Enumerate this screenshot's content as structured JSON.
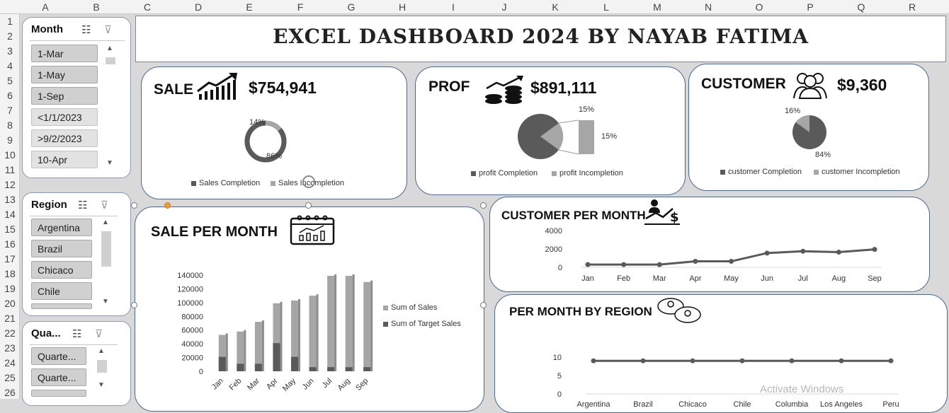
{
  "columns": [
    "A",
    "B",
    "C",
    "D",
    "E",
    "F",
    "G",
    "H",
    "I",
    "J",
    "K",
    "L",
    "M",
    "N",
    "O",
    "P",
    "Q",
    "R"
  ],
  "rows": [
    "1",
    "2",
    "3",
    "4",
    "5",
    "6",
    "7",
    "8",
    "9",
    "10",
    "11",
    "12",
    "13",
    "14",
    "15",
    "16",
    "17",
    "18",
    "19",
    "20",
    "21",
    "22",
    "23",
    "24",
    "25",
    "26"
  ],
  "title": "EXCEL DASHBOARD 2024 BY NAYAB FATIMA",
  "slicers": {
    "month": {
      "header": "Month",
      "items": [
        "1-Mar",
        "1-May",
        "1-Sep",
        "<1/1/2023",
        ">9/2/2023",
        "10-Apr"
      ]
    },
    "region": {
      "header": "Region",
      "items": [
        "Argentina",
        "Brazil",
        "Chicaco",
        "Chile"
      ]
    },
    "quarter": {
      "header": "Qua...",
      "items": [
        "Quarte...",
        "Quarte..."
      ]
    }
  },
  "kpis": {
    "sale": {
      "title": "SALE",
      "value": "$754,941",
      "pct_a": "14%",
      "pct_b": "86%",
      "legend": [
        "Sales Completion",
        "Sales Incompletion"
      ]
    },
    "prof": {
      "title": "PROF",
      "value": "$891,111",
      "pct_a": "15%",
      "pct_b": "15%",
      "legend": [
        "profit Completion",
        "profit Incompletion"
      ]
    },
    "customer": {
      "title": "CUSTOMER",
      "value": "$9,360",
      "pct_a": "16%",
      "pct_b": "84%",
      "legend": [
        "customer Completion",
        "customer Incompletion"
      ]
    }
  },
  "sections": {
    "sale_per_month": "SALE PER MONTH",
    "customer_per_month": "CUSTOMER PER MONTH",
    "per_month_by_region": "PER MONTH BY REGION"
  },
  "chart_data": [
    {
      "type": "bar",
      "categories": [
        "Jan",
        "Feb",
        "Mar",
        "Apr",
        "May",
        "Jun",
        "Jul",
        "Aug",
        "Sep"
      ],
      "yticks": [
        "140000",
        "120000",
        "100000",
        "80000",
        "60000",
        "40000",
        "20000",
        "0"
      ],
      "series": [
        {
          "name": "Sum of Sales",
          "values": [
            53000,
            58000,
            72000,
            99000,
            103000,
            110000,
            139000,
            139000,
            130000
          ]
        },
        {
          "name": "Sum of Target Sales",
          "values": [
            21000,
            11000,
            11000,
            41000,
            21000,
            6000,
            6000,
            6000,
            6000
          ]
        }
      ],
      "ylim": [
        0,
        140000
      ]
    },
    {
      "type": "line",
      "categories": [
        "Jan",
        "Feb",
        "Mar",
        "Apr",
        "May",
        "Jun",
        "Jul",
        "Aug",
        "Sep"
      ],
      "yticks": [
        "4000",
        "2000",
        "0"
      ],
      "values": [
        300,
        300,
        300,
        650,
        650,
        1550,
        1750,
        1650,
        1950
      ],
      "ylim": [
        0,
        4000
      ]
    },
    {
      "type": "line",
      "categories": [
        "Argentina",
        "Brazil",
        "Chicaco",
        "Chile",
        "Columbia",
        "Los Angeles",
        "Peru"
      ],
      "yticks": [
        "10",
        "5",
        "0"
      ],
      "values": [
        9,
        9,
        9,
        9,
        9,
        9,
        9
      ],
      "ylim": [
        0,
        10
      ]
    }
  ],
  "watermark": "Activate Windows",
  "colors": {
    "dark": "#5a5a5a",
    "light": "#a6a6a6",
    "border": "#4a6a8a"
  }
}
